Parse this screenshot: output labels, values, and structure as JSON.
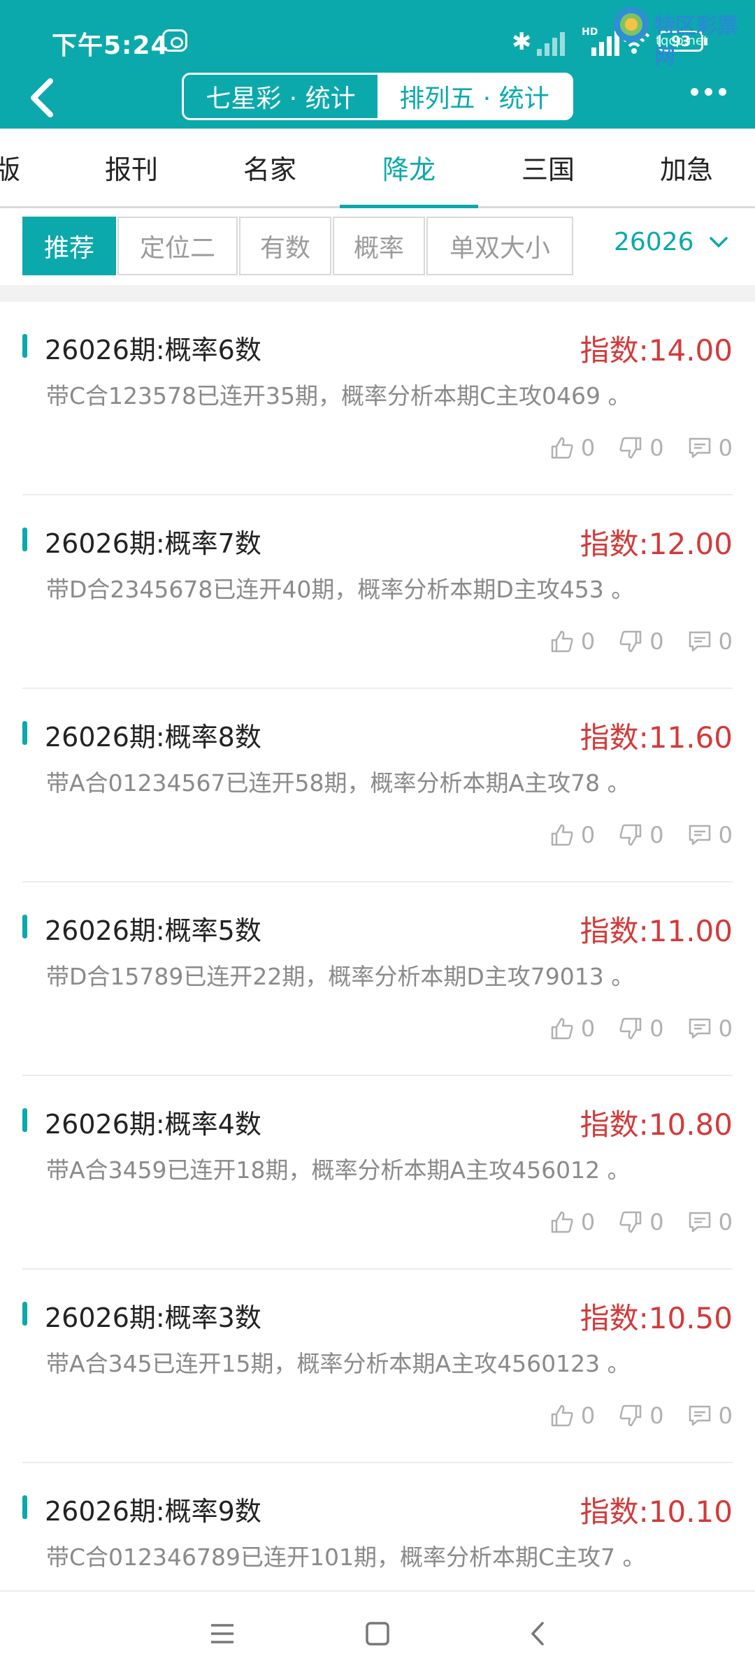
{
  "status": {
    "time": "下午5:24",
    "battery": "93"
  },
  "watermark": {
    "name": "特区彩票网",
    "url": "tqcp.net"
  },
  "header": {
    "segments": [
      "七星彩 · 统计",
      "排列五 · 统计"
    ],
    "active_segment": 1
  },
  "tabs": [
    "版",
    "报刊",
    "名家",
    "降龙",
    "三国",
    "加急"
  ],
  "active_tab": 3,
  "filters": [
    "推荐",
    "定位二",
    "有数",
    "概率",
    "单双大小"
  ],
  "active_filter": 0,
  "issue": "26026",
  "items": [
    {
      "title": "26026期:概率6数",
      "score": "指数:14.00",
      "desc": "带C合123578已连开35期，概率分析本期C主攻0469 。",
      "likes": "0",
      "dislikes": "0",
      "comments": "0"
    },
    {
      "title": "26026期:概率7数",
      "score": "指数:12.00",
      "desc": "带D合2345678已连开40期，概率分析本期D主攻453 。",
      "likes": "0",
      "dislikes": "0",
      "comments": "0"
    },
    {
      "title": "26026期:概率8数",
      "score": "指数:11.60",
      "desc": "带A合01234567已连开58期，概率分析本期A主攻78 。",
      "likes": "0",
      "dislikes": "0",
      "comments": "0"
    },
    {
      "title": "26026期:概率5数",
      "score": "指数:11.00",
      "desc": "带D合15789已连开22期，概率分析本期D主攻79013 。",
      "likes": "0",
      "dislikes": "0",
      "comments": "0"
    },
    {
      "title": "26026期:概率4数",
      "score": "指数:10.80",
      "desc": "带A合3459已连开18期，概率分析本期A主攻456012 。",
      "likes": "0",
      "dislikes": "0",
      "comments": "0"
    },
    {
      "title": "26026期:概率3数",
      "score": "指数:10.50",
      "desc": "带A合345已连开15期，概率分析本期A主攻4560123 。",
      "likes": "0",
      "dislikes": "0",
      "comments": "0"
    },
    {
      "title": "26026期:概率9数",
      "score": "指数:10.10",
      "desc": "带C合012346789已连开101期，概率分析本期C主攻7 。",
      "likes": "0",
      "dislikes": "0",
      "comments": "0"
    }
  ]
}
